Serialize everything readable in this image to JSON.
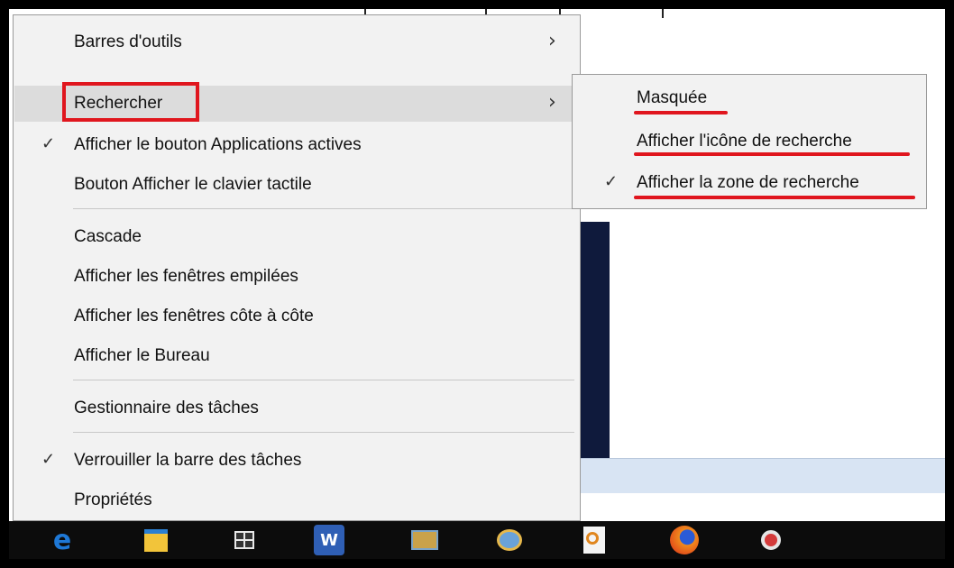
{
  "context_menu": {
    "items": [
      {
        "label": "Barres d'outils",
        "checked": false,
        "submenu": true
      },
      {
        "label": "Rechercher",
        "checked": false,
        "submenu": true,
        "highlighted": true
      },
      {
        "label": "Afficher le bouton Applications actives",
        "checked": true,
        "submenu": false
      },
      {
        "label": "Bouton Afficher le clavier tactile",
        "checked": false,
        "submenu": false
      },
      {
        "label": "Cascade",
        "checked": false,
        "submenu": false
      },
      {
        "label": "Afficher les fenêtres empilées",
        "checked": false,
        "submenu": false
      },
      {
        "label": "Afficher les fenêtres côte à côte",
        "checked": false,
        "submenu": false
      },
      {
        "label": "Afficher le Bureau",
        "checked": false,
        "submenu": false
      },
      {
        "label": "Gestionnaire des tâches",
        "checked": false,
        "submenu": false
      },
      {
        "label": "Verrouiller la barre des tâches",
        "checked": true,
        "submenu": false
      },
      {
        "label": "Propriétés",
        "checked": false,
        "submenu": false
      }
    ],
    "check_glyph": "✓",
    "arrow_glyph": "›"
  },
  "search_submenu": {
    "items": [
      {
        "label": "Masquée",
        "checked": false
      },
      {
        "label": "Afficher l'icône de recherche",
        "checked": false
      },
      {
        "label": "Afficher la zone de recherche",
        "checked": true
      }
    ]
  },
  "taskbar": {
    "icons": [
      "edge-icon",
      "file-explorer-icon",
      "windows-store-icon",
      "word-icon",
      "mail-icon",
      "paint-icon",
      "search-document-icon",
      "firefox-icon",
      "snipping-tool-icon"
    ]
  },
  "colors": {
    "annotation_red": "#e0161e",
    "menu_bg": "#f2f2f2",
    "hover_bg": "#dcdcdc",
    "taskbar_bg": "#0c0c0c"
  }
}
